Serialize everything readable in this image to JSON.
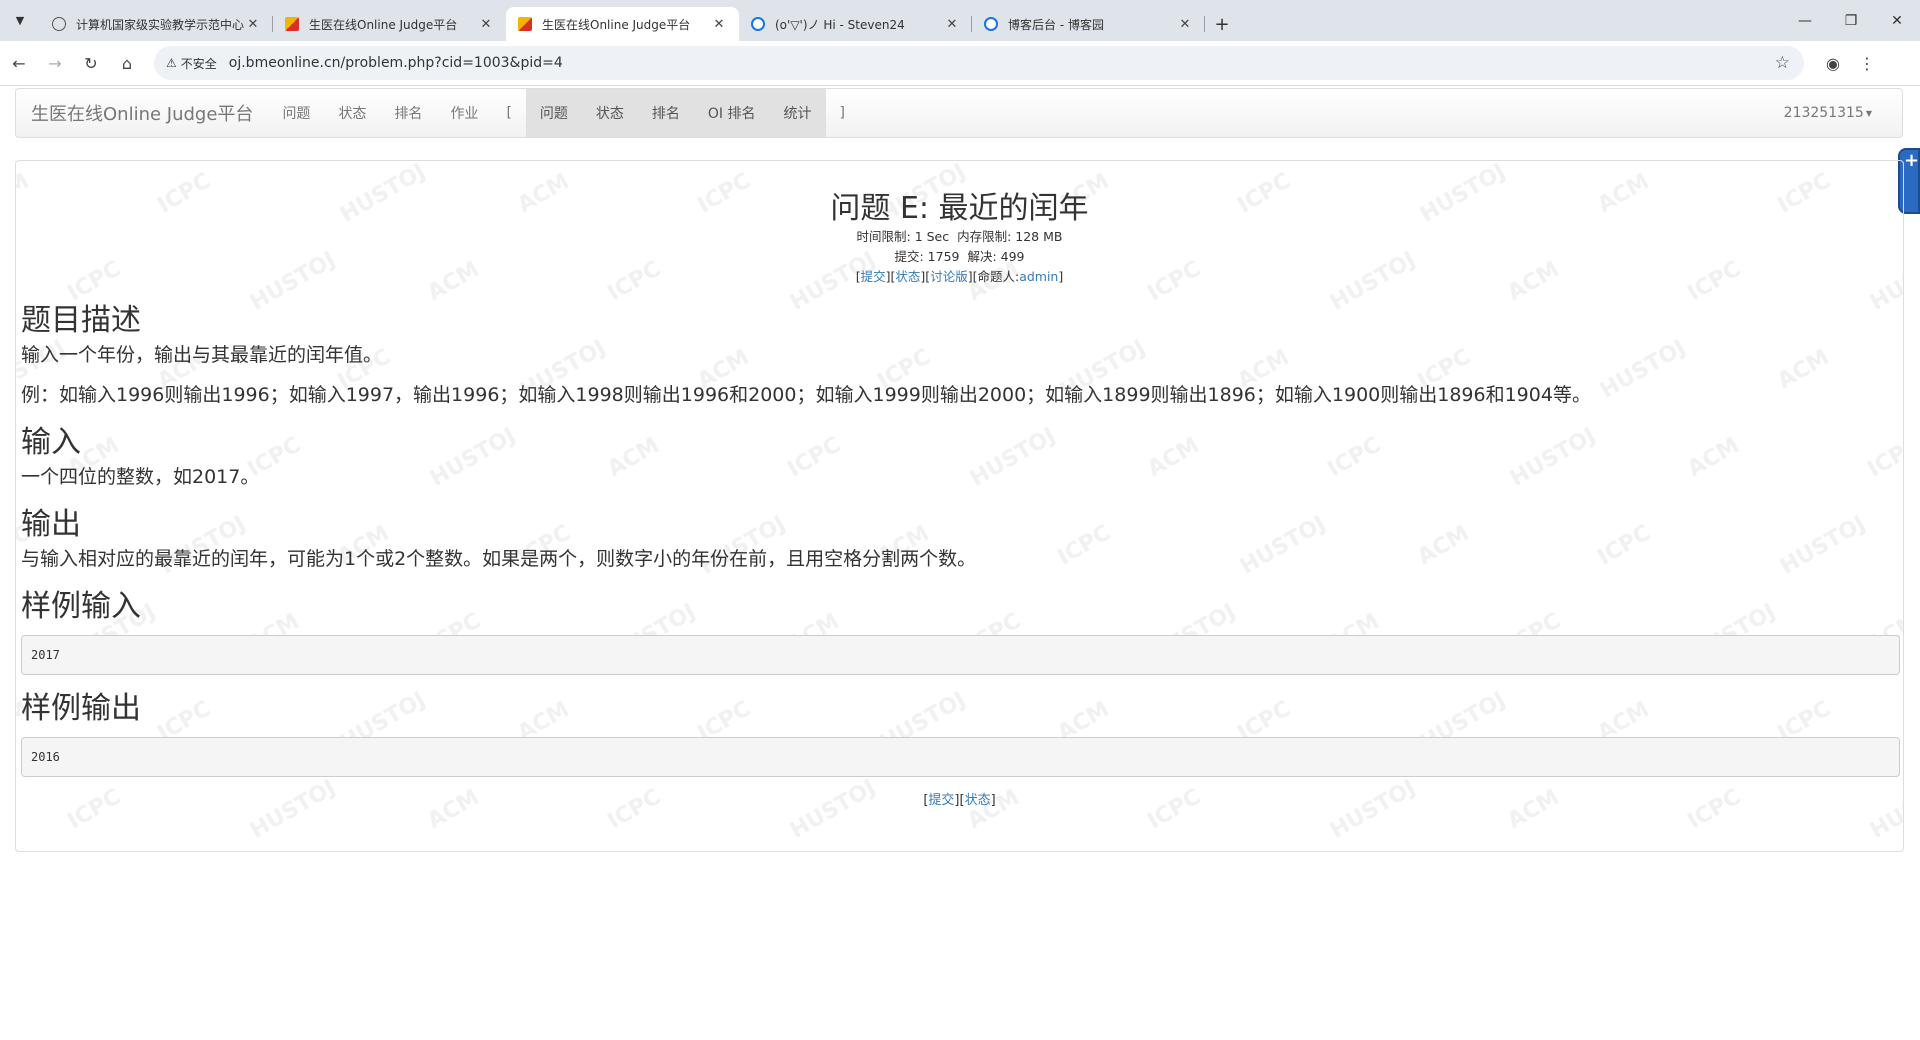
{
  "browser": {
    "tabs": [
      {
        "title": "计算机国家级实验教学示范中心",
        "icon": "globe-icon",
        "active": false
      },
      {
        "title": "生医在线Online Judge平台",
        "icon": "oj-favicon",
        "active": false
      },
      {
        "title": "生医在线Online Judge平台",
        "icon": "oj-favicon",
        "active": true
      },
      {
        "title": "(o'▽')ノ Hi - Steven24",
        "icon": "blog-icon",
        "active": false
      },
      {
        "title": "博客后台 - 博客园",
        "icon": "cnblogs-icon",
        "active": false
      }
    ],
    "security_label": "不安全",
    "url": "oj.bmeonline.cn/problem.php?cid=1003&pid=4"
  },
  "navbar": {
    "brand": "生医在线Online Judge平台",
    "items": [
      "问题",
      "状态",
      "排名",
      "作业",
      "["
    ],
    "contest_items": [
      "问题",
      "状态",
      "排名",
      "OI 排名",
      "统计"
    ],
    "close_bracket": "]",
    "user": "213251315"
  },
  "problem": {
    "title": "问题 E: 最近的闰年",
    "time_limit": "时间限制: 1 Sec",
    "memory_limit": "内存限制: 128 MB",
    "submit_count": "提交: 1759",
    "solved_count": "解决: 499",
    "links": {
      "submit": "提交",
      "status": "状态",
      "discuss": "讨论版",
      "author_label": "命题人:",
      "author": "admin"
    },
    "sections": {
      "description_h": "题目描述",
      "description_1": "输入一个年份，输出与其最靠近的闰年值。",
      "description_2": "例：如输入1996则输出1996；如输入1997，输出1996；如输入1998则输出1996和2000；如输入1999则输出2000；如输入1899则输出1896；如输入1900则输出1896和1904等。",
      "input_h": "输入",
      "input": "一个四位的整数，如2017。",
      "output_h": "输出",
      "output": "与输入相对应的最靠近的闰年，可能为1个或2个整数。如果是两个，则数字小的年份在前，且用空格分割两个数。",
      "sample_in_h": "样例输入",
      "sample_in": "2017",
      "sample_out_h": "样例输出",
      "sample_out": "2016"
    },
    "footer": {
      "submit": "提交",
      "status": "状态"
    }
  },
  "watermark": [
    "ACM",
    "ICPC",
    "HUSTOJ"
  ]
}
